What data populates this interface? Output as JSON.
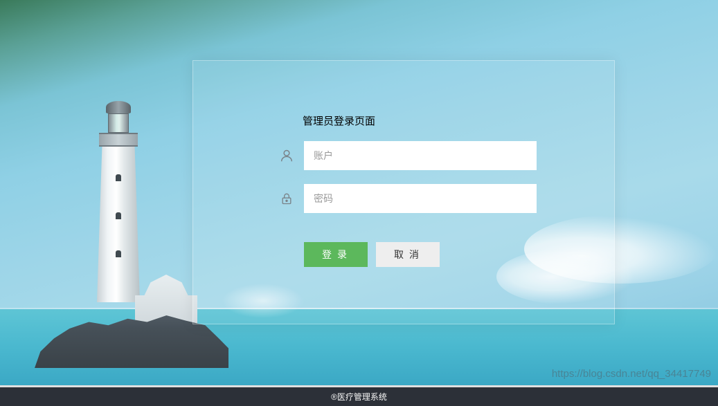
{
  "login": {
    "title": "管理员登录页面",
    "username_placeholder": "账户",
    "password_placeholder": "密码",
    "login_button_label": "登录",
    "cancel_button_label": "取消"
  },
  "footer": {
    "text": "®医疗管理系统"
  },
  "watermark": {
    "text": "https://blog.csdn.net/qq_34417749"
  },
  "colors": {
    "button_primary": "#5cb85c",
    "button_secondary": "#eeeeee",
    "footer_bg": "#2c3038"
  },
  "icons": {
    "username": "user-icon",
    "password": "lock-icon"
  }
}
